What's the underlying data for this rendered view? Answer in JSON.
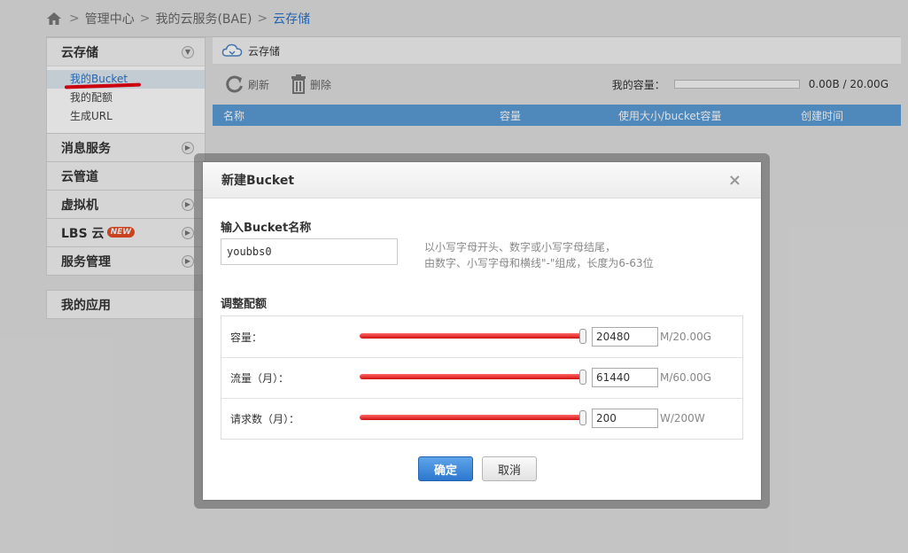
{
  "breadcrumb": {
    "items": [
      "管理中心",
      "我的云服务(BAE)",
      "云存储"
    ],
    "sep": ">"
  },
  "sidebar": {
    "groups": [
      {
        "label": "云存储",
        "sub": [
          "我的Bucket",
          "我的配额",
          "生成URL"
        ]
      },
      {
        "label": "消息服务"
      },
      {
        "label": "云管道"
      },
      {
        "label": "虚拟机"
      },
      {
        "label": "LBS 云",
        "badge": "NEW"
      },
      {
        "label": "服务管理"
      }
    ],
    "apps": "我的应用"
  },
  "main": {
    "title": "云存储",
    "toolbar": {
      "refresh": "刷新",
      "delete": "删除",
      "capacity_label": "我的容量：",
      "capacity_value": "0.00B / 20.00G",
      "capacity_fraction": 0
    },
    "table_headers": [
      "名称",
      "容量",
      "使用大小/bucket容量",
      "创建时间"
    ]
  },
  "modal": {
    "title": "新建Bucket",
    "close": "×",
    "name_label": "输入Bucket名称",
    "name_value": "youbbs0",
    "hint_line1": "以小写字母开头、数字或小写字母结尾，",
    "hint_line2": "由数字、小写字母和横线\"-\"组成，长度为6-63位",
    "quota_label": "调整配额",
    "quotas": [
      {
        "label": "容量：",
        "value": "20480",
        "unit": "M/20.00G",
        "fraction": 1.0
      },
      {
        "label": "流量（月）：",
        "value": "61440",
        "unit": "M/60.00G",
        "fraction": 1.0
      },
      {
        "label": "请求数（月）：",
        "value": "200",
        "unit": "W/200W",
        "fraction": 1.0
      }
    ],
    "ok": "确定",
    "cancel": "取消"
  },
  "colors": {
    "accent": "#2a73c6",
    "table_header": "#5b9bd5",
    "slider": "#e60012",
    "annotation": "#e60012"
  }
}
